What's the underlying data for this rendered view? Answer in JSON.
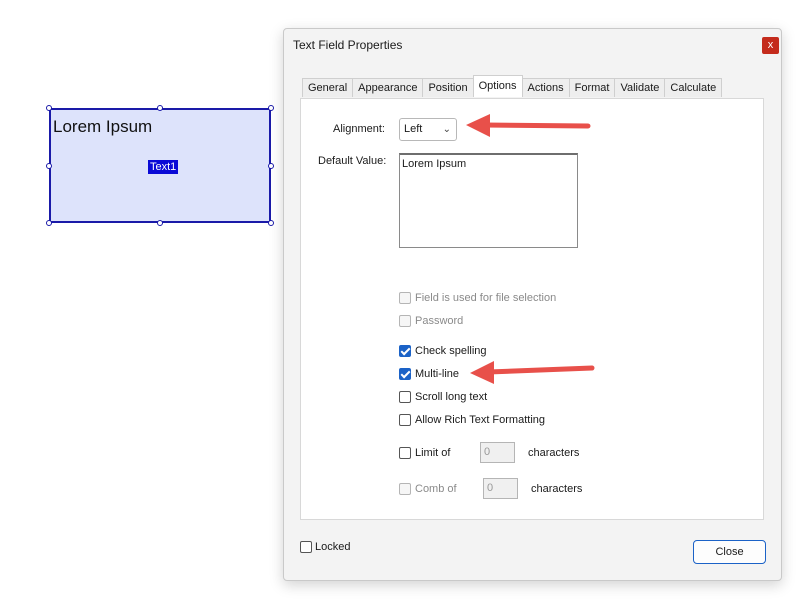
{
  "canvas": {
    "field_value": "Lorem Ipsum",
    "field_name": "Text1"
  },
  "dialog": {
    "title": "Text Field Properties",
    "close_glyph": "x",
    "tabs": [
      "General",
      "Appearance",
      "Position",
      "Options",
      "Actions",
      "Format",
      "Validate",
      "Calculate"
    ],
    "active_tab": "Options",
    "alignment": {
      "label": "Alignment:",
      "value": "Left"
    },
    "default_value": {
      "label": "Default Value:",
      "value": "Lorem Ipsum"
    },
    "checkboxes": {
      "file_selection": {
        "label": "Field is used for file selection",
        "checked": false,
        "enabled": false
      },
      "password": {
        "label": "Password",
        "checked": false,
        "enabled": false
      },
      "check_spelling": {
        "label": "Check spelling",
        "checked": true,
        "enabled": true
      },
      "multi_line": {
        "label": "Multi-line",
        "checked": true,
        "enabled": true
      },
      "scroll_long_text": {
        "label": "Scroll long text",
        "checked": false,
        "enabled": true
      },
      "rich_text": {
        "label": "Allow Rich Text Formatting",
        "checked": false,
        "enabled": true
      }
    },
    "limit": {
      "label": "Limit of",
      "value": "0",
      "suffix": "characters",
      "enabled": true
    },
    "comb": {
      "label": "Comb of",
      "value": "0",
      "suffix": "characters",
      "enabled": false
    },
    "locked": {
      "label": "Locked",
      "checked": false
    },
    "close_button": "Close"
  },
  "colors": {
    "accent": "#1b62c7",
    "annotation_arrow": "#e8504a",
    "field_fill": "#dde3fb",
    "field_border": "#1a1aa8"
  }
}
